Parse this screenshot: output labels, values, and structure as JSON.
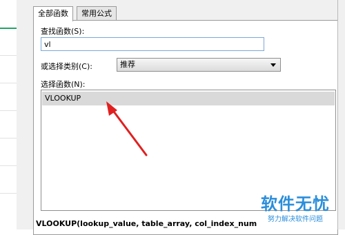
{
  "tabs": {
    "all_functions": "全部函数",
    "common_formulas": "常用公式"
  },
  "search": {
    "label": "查找函数(S):",
    "value": "vl"
  },
  "category": {
    "label": "或选择类别(C):",
    "selected": "推荐"
  },
  "function_list": {
    "label": "选择函数(N):",
    "items": [
      "VLOOKUP"
    ]
  },
  "signature": "VLOOKUP(lookup_value, table_array, col_index_num",
  "watermark": {
    "title": "软件无忧",
    "subtitle": "努力解决软件问题"
  },
  "colors": {
    "annotation_arrow": "#e02020",
    "selection": "#d9d9d9",
    "input_focus_border": "#7aa7d8",
    "sheet_selection": "#21a366"
  },
  "icons": {
    "dropdown": "chevron-down-icon",
    "annotation": "red-arrow-icon"
  }
}
